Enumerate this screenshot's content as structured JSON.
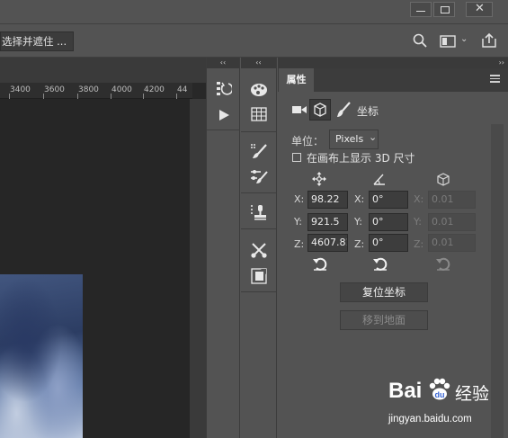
{
  "options_bar": {
    "select_mask_button": "选择并遮住 ..."
  },
  "ruler": {
    "ticks": [
      "3400",
      "3600",
      "3800",
      "4000",
      "4200",
      "44"
    ]
  },
  "collapse_glyph": "‹‹",
  "collapse_glyph_right": "››",
  "properties": {
    "tab_label": "属性",
    "section_label": "坐标",
    "unit_label": "单位：",
    "unit_value": "Pixels",
    "show_3d_checkbox_label": "在画布上显示 3D 尺寸",
    "show_3d_checked": false,
    "position": {
      "x": "98.22",
      "y": "921.5",
      "z": "4607.81"
    },
    "rotation": {
      "x": "0°",
      "y": "0°",
      "z": "0°"
    },
    "scale": {
      "x": "0.01",
      "y": "0.01",
      "z": "0.01"
    },
    "axis_labels": {
      "x": "X:",
      "y": "Y:",
      "z": "Z:"
    },
    "reset_coords_button": "复位坐标",
    "move_to_ground_button": "移到地面"
  },
  "watermark": {
    "brand_text": "Bai",
    "brand_text_2": "du",
    "brand_cn": "经验",
    "url": "jingyan.baidu.com"
  },
  "colors": {
    "panel_bg": "#535353",
    "dark_bg": "#282828",
    "accent_text": "#f0f0f0"
  }
}
